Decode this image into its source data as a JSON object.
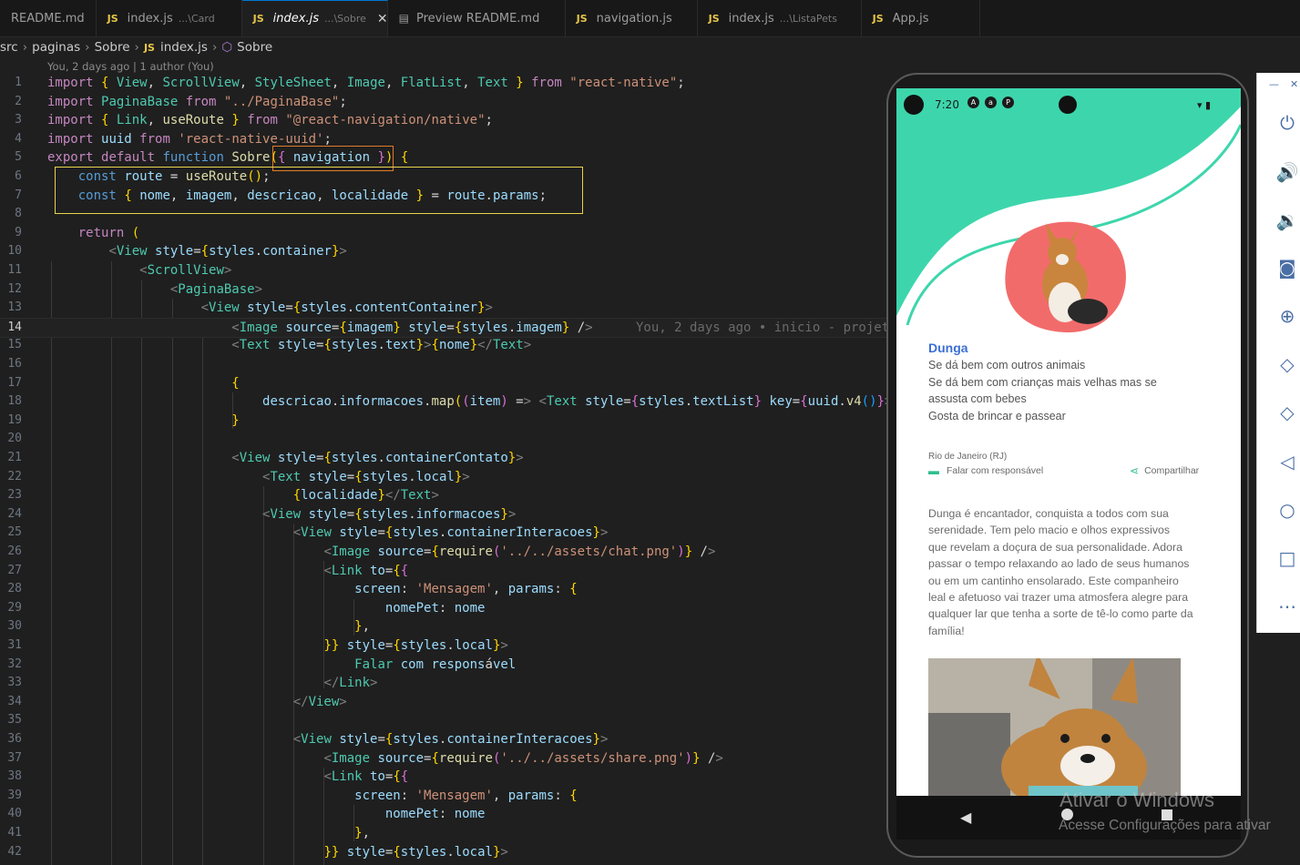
{
  "tabs": [
    {
      "icon": "",
      "name": "README.md",
      "dir": "",
      "active": false
    },
    {
      "icon": "JS",
      "name": "index.js",
      "dir": "...\\Card",
      "active": false
    },
    {
      "icon": "JS",
      "name": "index.js",
      "dir": "...\\Sobre",
      "active": true
    },
    {
      "icon": "",
      "name": "Preview README.md",
      "dir": "",
      "active": false
    },
    {
      "icon": "JS",
      "name": "navigation.js",
      "dir": "",
      "active": false
    },
    {
      "icon": "JS",
      "name": "index.js",
      "dir": "...\\ListaPets",
      "active": false
    },
    {
      "icon": "JS",
      "name": "App.js",
      "dir": "",
      "active": false
    }
  ],
  "breadcrumb": {
    "parts": [
      "src",
      "paginas",
      "Sobre"
    ],
    "file": "index.js",
    "symbol": "Sobre",
    "js_label": "JS"
  },
  "blame": "You, 2 days ago | 1 author (You)",
  "current_line": 14,
  "code": [
    "import { View, ScrollView, StyleSheet, Image, FlatList, Text } from \"react-native\";",
    "import PaginaBase from \"../PaginaBase\";",
    "import { Link, useRoute } from \"@react-navigation/native\";",
    "import uuid from 'react-native-uuid';",
    "export default function Sobre({ navigation }) {",
    "    const route = useRoute();",
    "    const { nome, imagem, descricao, localidade } = route.params;",
    "",
    "    return (",
    "        <View style={styles.container}>",
    "            <ScrollView>",
    "                <PaginaBase>",
    "                    <View style={styles.contentContainer}>",
    "                        <Image source={imagem} style={styles.imagem} />",
    "                        <Text style={styles.text}>{nome}</Text>",
    "",
    "                        {",
    "                            descricao.informacoes.map((item) => <Text style={styles.textList} key={uuid.v4()}>",
    "                        }",
    "",
    "                        <View style={styles.containerContato}>",
    "                            <Text style={styles.local}>",
    "                                {localidade}</Text>",
    "                            <View style={styles.informacoes}>",
    "                                <View style={styles.containerInteracoes}>",
    "                                    <Image source={require('../../assets/chat.png')} />",
    "                                    <Link to={{",
    "                                        screen: 'Mensagem', params: {",
    "                                            nomePet: nome",
    "                                        },",
    "                                    }} style={styles.local}>",
    "                                        Falar com responsável",
    "                                    </Link>",
    "                                </View>",
    "",
    "                                <View style={styles.containerInteracoes}>",
    "                                    <Image source={require('../../assets/share.png')} />",
    "                                    <Link to={{",
    "                                        screen: 'Mensagem', params: {",
    "                                            nomePet: nome",
    "                                        },",
    "                                    }} style={styles.local}>"
  ],
  "inline_blame": "You, 2 days ago • inicio - projet",
  "phone": {
    "time": "7:20",
    "pet_name": "Dunga",
    "info_lines": [
      "Se dá bem com outros animais",
      "Se dá bem com crianças mais velhas mas se",
      "assusta com bebes",
      "Gosta de brincar e passear"
    ],
    "location": "Rio de Janeiro (RJ)",
    "contact_label": "Falar com responsável",
    "share_label": "Compartilhar",
    "about_lines": [
      "Dunga é encantador, conquista a todos com sua",
      "serenidade. Tem pelo macio e olhos expressivos",
      "que revelam a doçura de sua personalidade. Adora",
      "passar o tempo relaxando ao lado de seus humanos",
      "ou em um cantinho ensolarado. Este companheiro",
      "leal e afetuoso vai trazer uma atmosfera alegre para",
      "qualquer lar que tenha a sorte de tê-lo como parte da",
      "família!"
    ],
    "theme_color": "#3dd6ac",
    "accent_blob": "#f26b6b"
  },
  "emulator_toolbar": [
    "power-icon",
    "volume-up-icon",
    "volume-down-icon",
    "camera-icon",
    "zoom-icon",
    "rotate-left-icon",
    "rotate-right-icon",
    "back-icon",
    "home-icon",
    "overview-icon",
    "more-icon"
  ],
  "watermark": {
    "line1": "Ativar o Windows",
    "line2": "Acesse Configurações para ativar"
  }
}
